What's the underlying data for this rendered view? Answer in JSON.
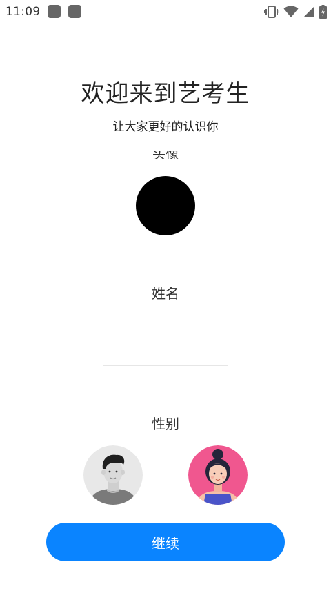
{
  "status_bar": {
    "time": "11:09",
    "icons": [
      "notification-icon",
      "notification-icon",
      "vibrate-icon",
      "wifi-icon",
      "signal-icon",
      "battery-icon"
    ]
  },
  "header": {
    "title": "欢迎来到艺考生",
    "subtitle": "让大家更好的认识你"
  },
  "avatar": {
    "label": "头像"
  },
  "name": {
    "label": "姓名",
    "value": "",
    "placeholder": ""
  },
  "gender": {
    "label": "性别",
    "options": [
      "male-avatar",
      "female-avatar"
    ]
  },
  "actions": {
    "continue_label": "继续"
  },
  "colors": {
    "accent": "#0a84ff",
    "female_bg": "#f0578f",
    "male_bg": "#e8e8e8"
  }
}
